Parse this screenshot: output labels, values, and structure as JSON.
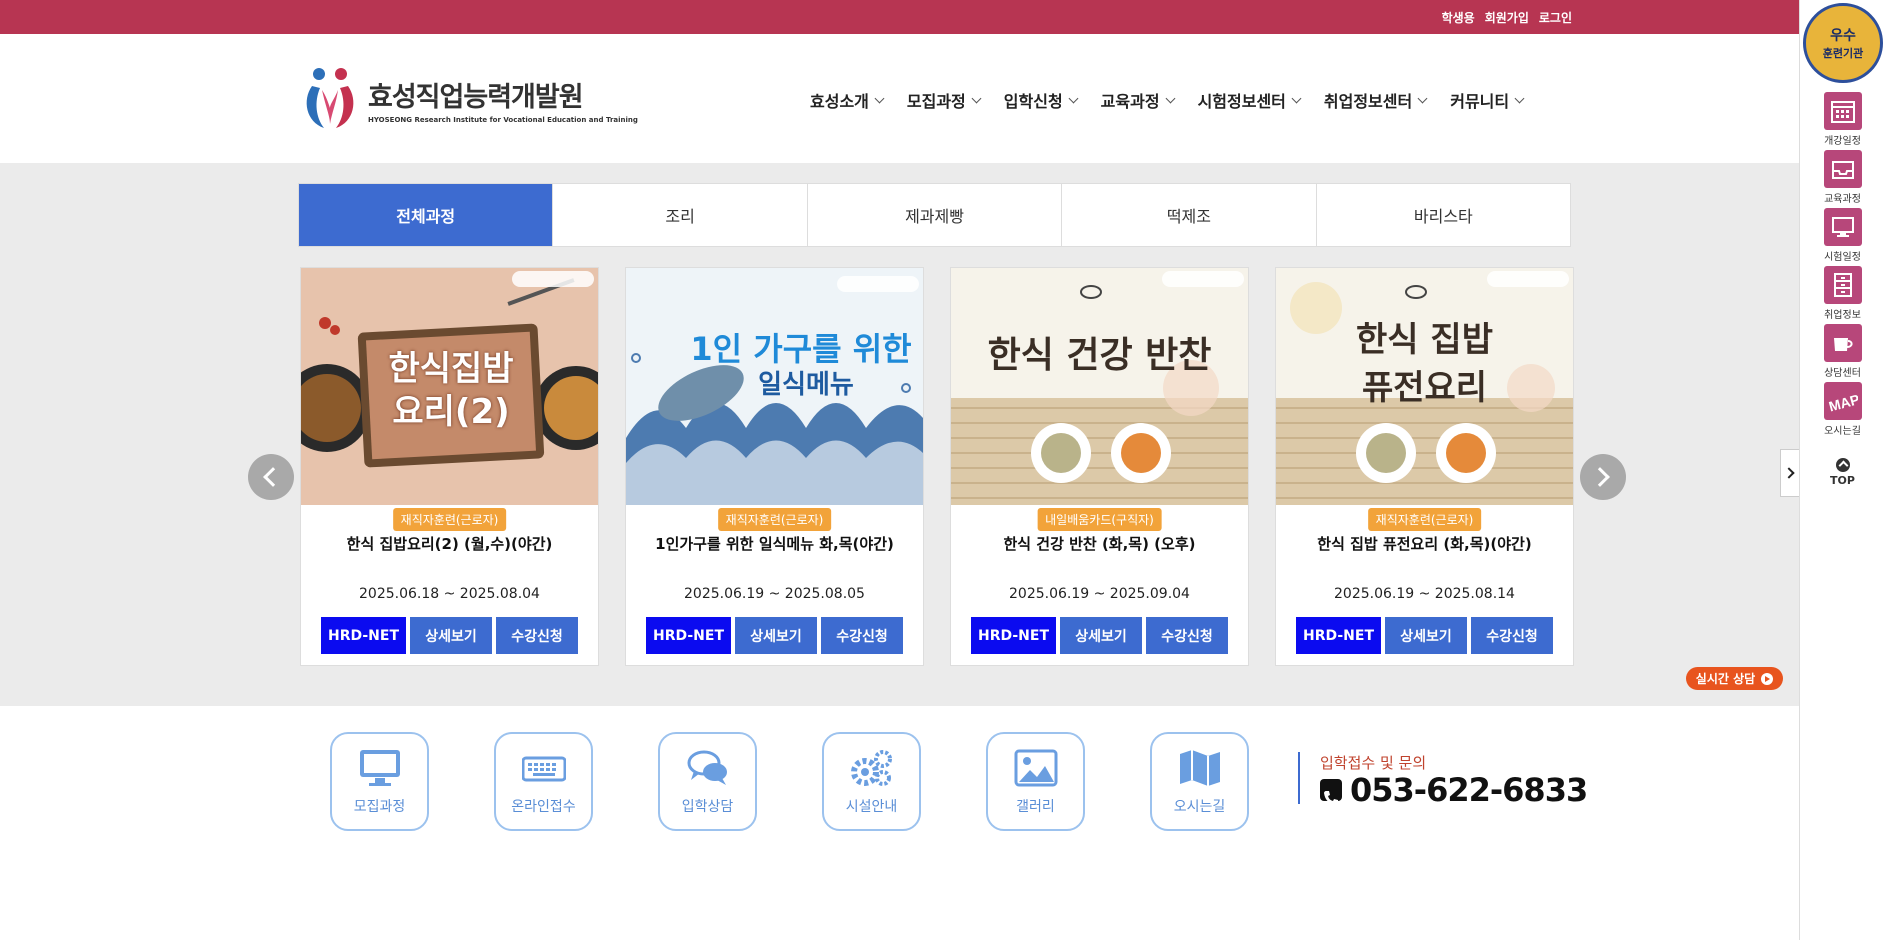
{
  "top_links": [
    "학생용",
    "회원가입",
    "로그인"
  ],
  "logo": {
    "title": "효성직업능력개발원",
    "subtitle": "HYOSEONG Research Institute for Vocational Education and Training"
  },
  "nav": [
    "효성소개",
    "모집과정",
    "입학신청",
    "교육과정",
    "시험정보센터",
    "취업정보센터",
    "커뮤니티"
  ],
  "tabs": [
    {
      "label": "전체과정",
      "active": true
    },
    {
      "label": "조리",
      "active": false
    },
    {
      "label": "제과제빵",
      "active": false
    },
    {
      "label": "떡제조",
      "active": false
    },
    {
      "label": "바리스타",
      "active": false
    }
  ],
  "courses": [
    {
      "thumb_text": "한식집밥 요리(2)",
      "badge": "재직자훈련(근로자)",
      "title": "한식 집밥요리(2) (월,수)(야간)",
      "date": "2025.06.18 ~ 2025.08.04"
    },
    {
      "thumb_text_1": "1인 가구를 위한",
      "thumb_text_2": "일식메뉴",
      "badge": "재직자훈련(근로자)",
      "title": "1인가구를 위한 일식메뉴 화,목(야간)",
      "date": "2025.06.19 ~ 2025.08.05"
    },
    {
      "thumb_text": "한식 건강 반찬",
      "badge": "내일배움카드(구직자)",
      "title": "한식 건강 반찬 (화,목) (오후)",
      "date": "2025.06.19 ~ 2025.09.04"
    },
    {
      "thumb_text_1": "한식 집밥",
      "thumb_text_2": "퓨전요리",
      "badge": "재직자훈련(근로자)",
      "title": "한식 집밥 퓨전요리 (화,목)(야간)",
      "date": "2025.06.19 ~ 2025.08.14"
    }
  ],
  "card_buttons": {
    "hrd": "HRD-NET",
    "detail": "상세보기",
    "apply": "수강신청"
  },
  "chat_label": "실시간 상담",
  "quick_menu": [
    "모집과정",
    "온라인접수",
    "입학상담",
    "시설안내",
    "갤러리",
    "오시는길"
  ],
  "contact": {
    "label": "입학접수 및 문의",
    "phone": "053-622-6833"
  },
  "seal": {
    "line1": "우수",
    "line2": "훈련기관"
  },
  "side_menu": [
    "개강일정",
    "교육과정",
    "시험일정",
    "취업정보",
    "상담센터",
    "오시는길"
  ],
  "top_label": "TOP",
  "colors": {
    "brand": "#b73552",
    "accent": "#3d6bd0",
    "hrd": "#0b0bf0",
    "badge": "#f2a33a"
  }
}
